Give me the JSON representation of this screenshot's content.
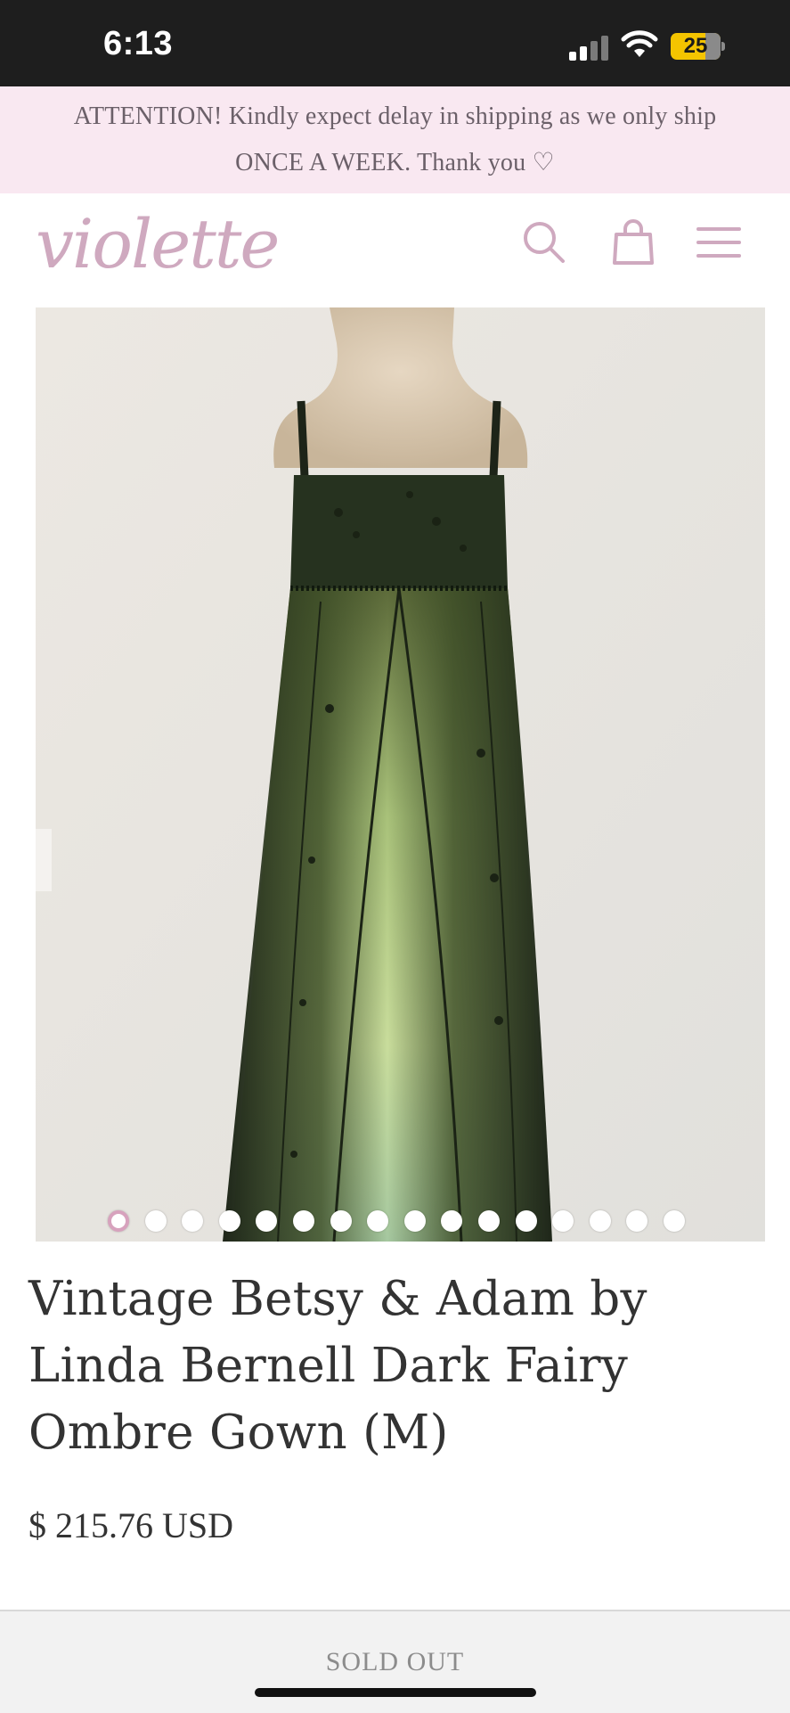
{
  "status_bar": {
    "time": "6:13",
    "battery_level": 25,
    "battery_label": "25",
    "icons": [
      "signal-icon",
      "wifi-icon",
      "battery-icon"
    ]
  },
  "announcement": {
    "line1": "ATTENTION! Kindly expect delay in shipping as we only ship",
    "line2": "ONCE A WEEK. Thank you ♡"
  },
  "header": {
    "logo_text": "violette",
    "icons": [
      "search-icon",
      "cart-icon",
      "menu-icon"
    ]
  },
  "gallery": {
    "image_count": 16,
    "active_index": 0
  },
  "product": {
    "title": "Vintage Betsy & Adam by Linda Bernell Dark Fairy Ombre Gown (M)",
    "price": "$ 215.76 USD"
  },
  "footer": {
    "sold_out_label": "SOLD OUT"
  },
  "colors": {
    "announcement_bg": "#f9e8f1",
    "logo": "#cfa9bf",
    "icon": "#cfa9bf",
    "battery": "#f4c400"
  }
}
